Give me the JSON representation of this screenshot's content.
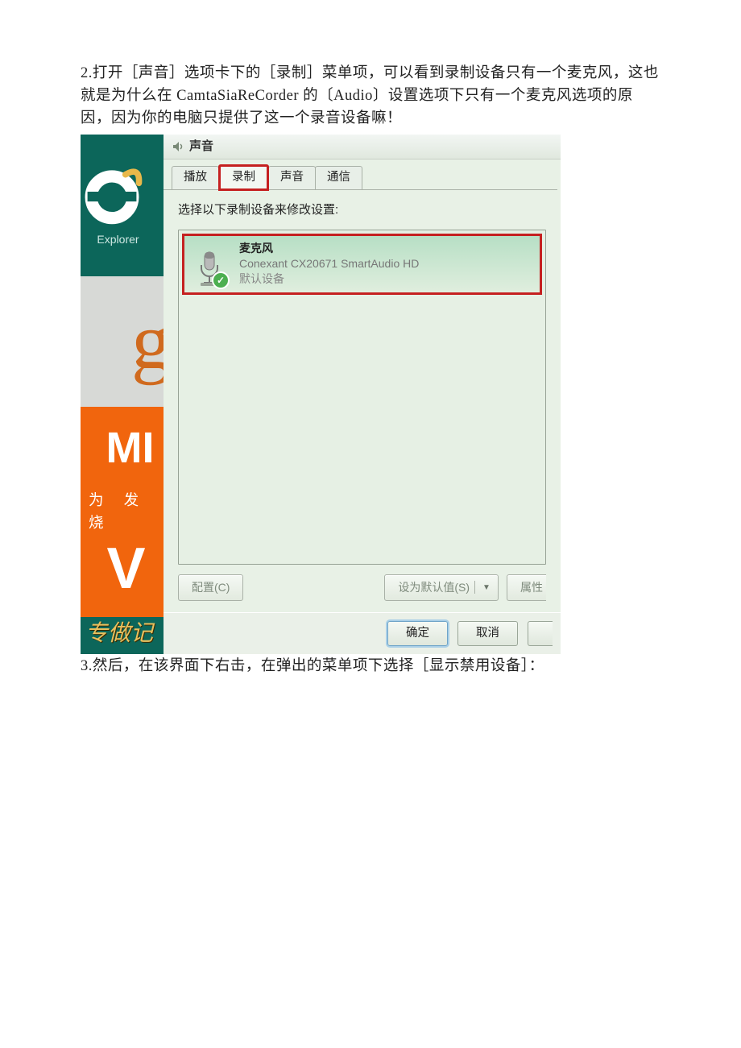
{
  "step2": "2.打开［声音］选项卡下的［录制］菜单项，可以看到录制设备只有一个麦克风，这也就是为什么在 CamtaSiaReCorder 的〔Audio〕设置选项下只有一个麦克风选项的原因，因为你的电脑只提供了这一个录音设备嘛！",
  "dialog": {
    "title": "声音",
    "tabs": [
      "播放",
      "录制",
      "声音",
      "通信"
    ],
    "activeTab": 1,
    "instruction": "选择以下录制设备来修改设置:",
    "device": {
      "name": "麦克风",
      "desc": "Conexant CX20671 SmartAudio HD",
      "status": "默认设备"
    },
    "buttons": {
      "configure": "配置(C)",
      "setDefault": "设为默认值(S)",
      "properties": "属性",
      "ok": "确定",
      "cancel": "取消"
    }
  },
  "desktop": {
    "ieLabel": "Explorer",
    "mi": "MI",
    "miSub": "为 发 烧",
    "v": "V",
    "bottom": "专做记"
  },
  "step3": "3.然后，在该界面下右击，在弹出的菜单项下选择［显示禁用设备］："
}
